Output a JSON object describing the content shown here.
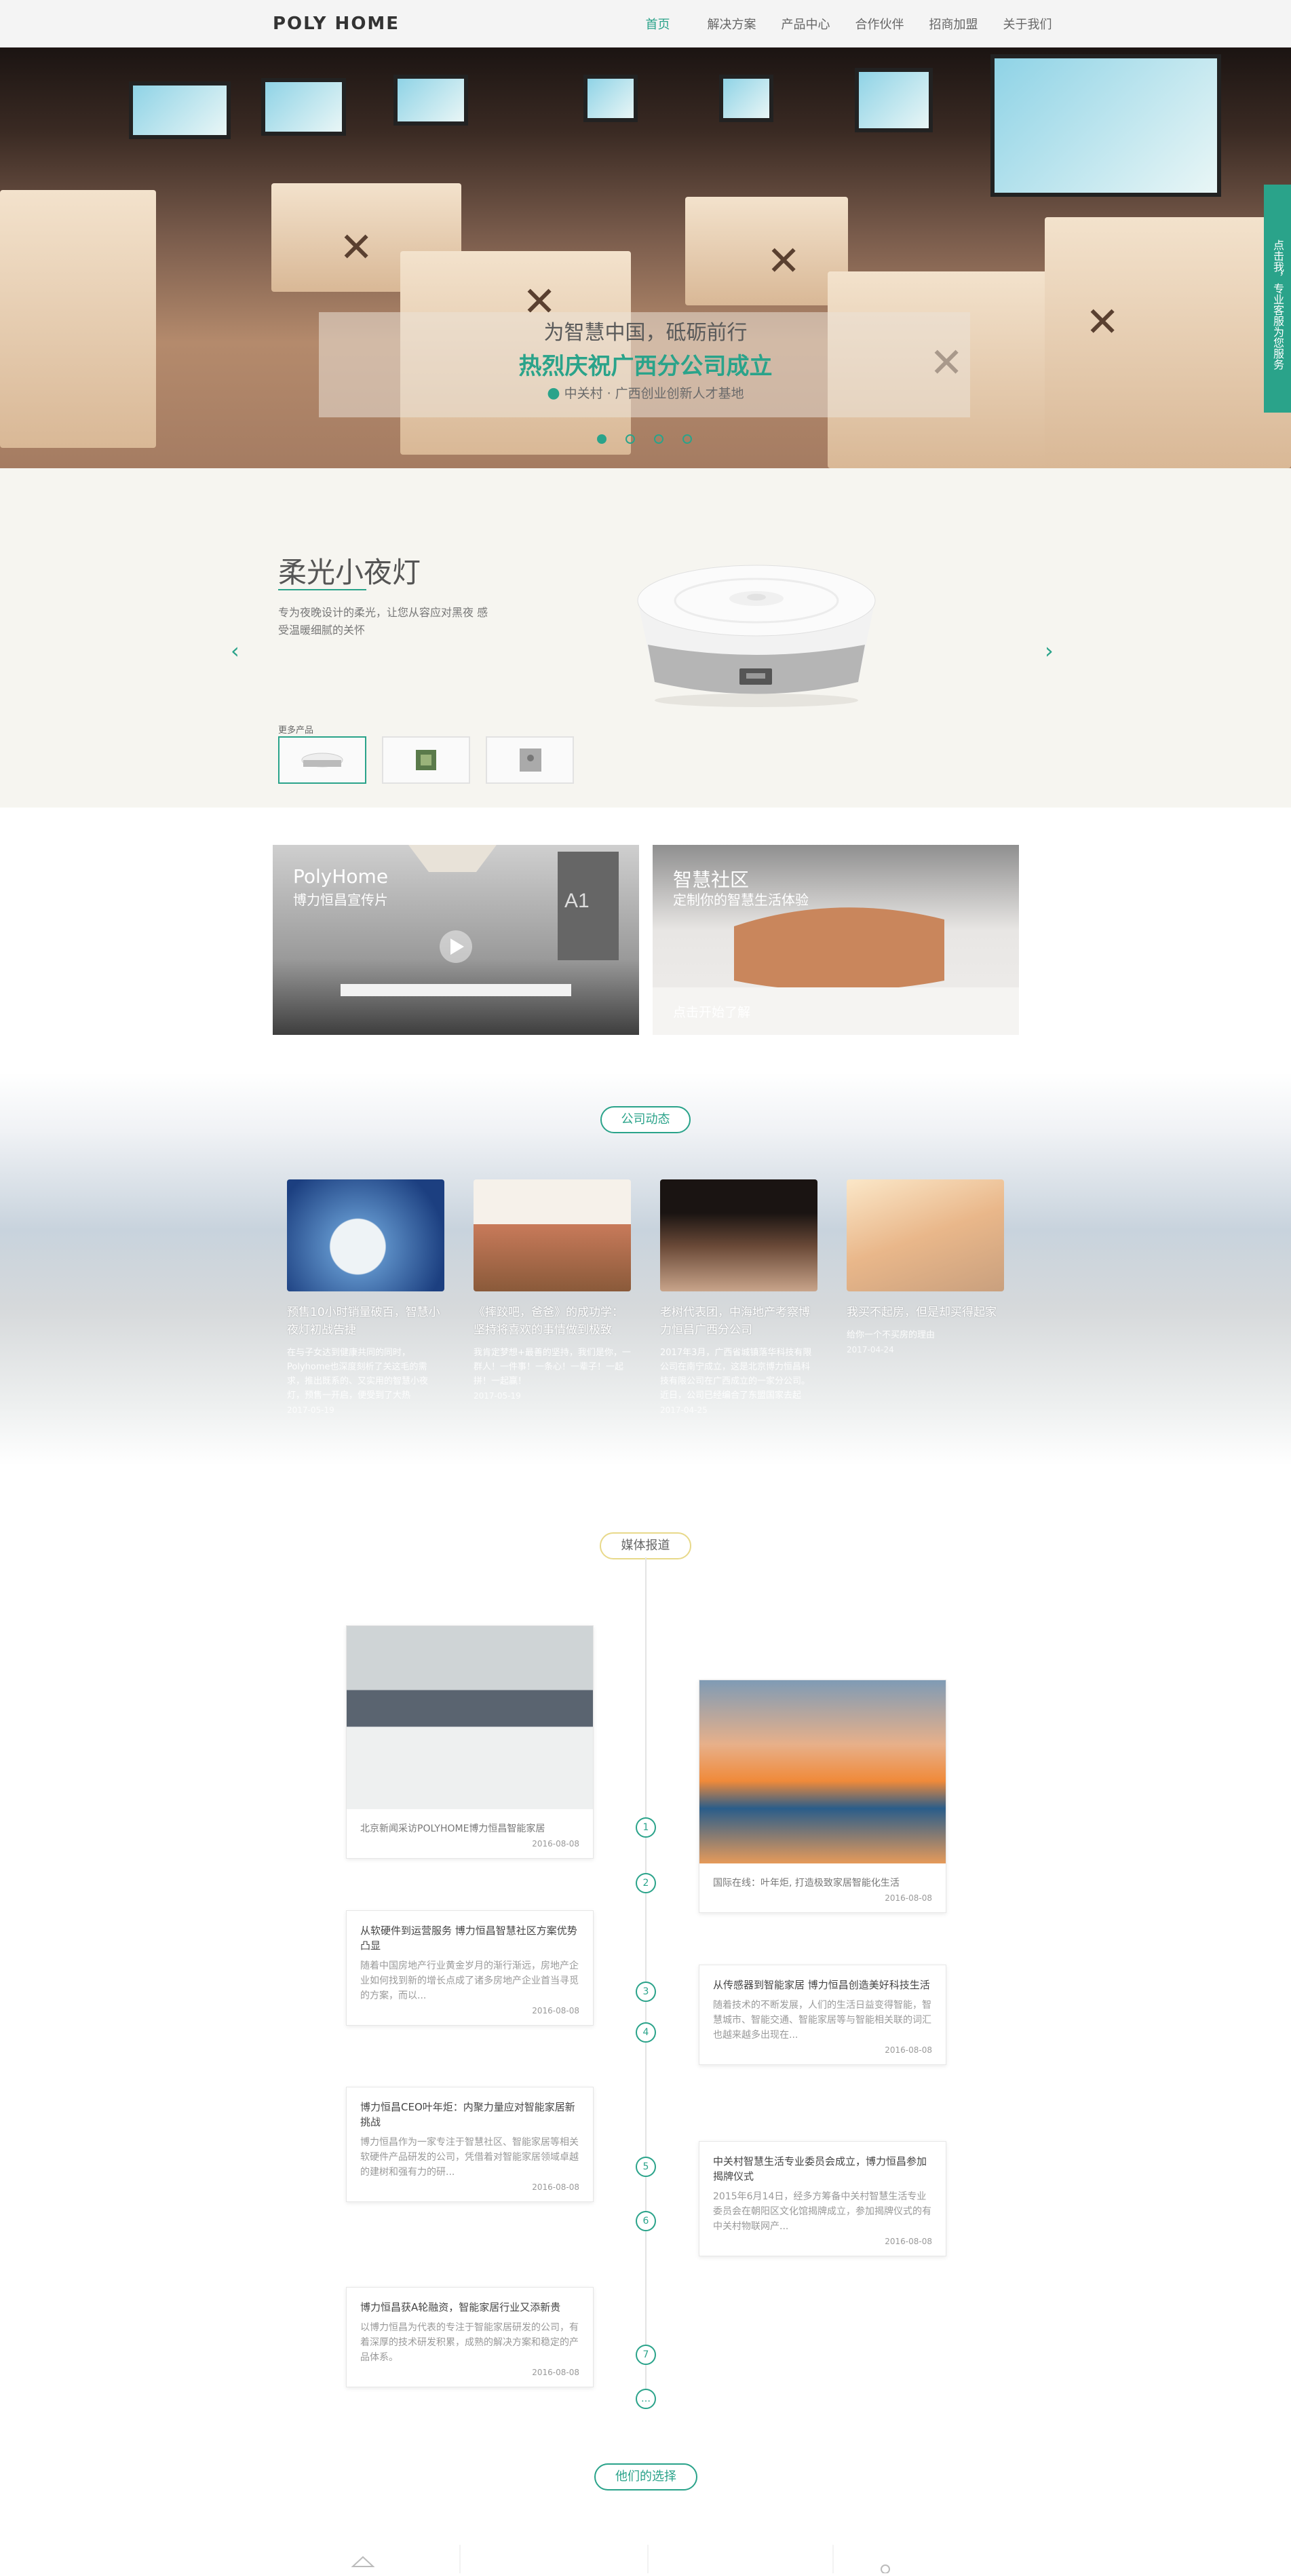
{
  "header": {
    "logo": "POLY HOME",
    "nav": [
      {
        "label": "首页",
        "active": true
      },
      {
        "label": "解决方案",
        "active": false
      },
      {
        "label": "产品中心",
        "active": false
      },
      {
        "label": "合作伙伴",
        "active": false
      },
      {
        "label": "招商加盟",
        "active": false
      },
      {
        "label": "关于我们",
        "active": false
      }
    ]
  },
  "hero": {
    "line1": "为智慧中国，砥砺前行",
    "line2": "热烈庆祝广西分公司成立",
    "location": "中关村 · 广西创业创新人才基地",
    "slides": 4,
    "active_slide": 1
  },
  "float_tab": {
    "label": "点击我，专业客服为您服务"
  },
  "product": {
    "title": "柔光小夜灯",
    "desc": "专为夜晚设计的柔光，让您从容应对黑夜 感受温暖细腻的关怀",
    "more_label": "更多产品",
    "arrow_left": "‹",
    "arrow_right": "›"
  },
  "video_cards": [
    {
      "title": "PolyHome",
      "subtitle": "博力恒昌宣传片",
      "cta": ""
    },
    {
      "title": "智慧社区",
      "subtitle": "定制你的智慧生活体验",
      "cta": "点击开始了解"
    }
  ],
  "news": {
    "label": "公司动态",
    "items": [
      {
        "title": "预售10小时销量破百，智慧小夜灯初战告捷",
        "text": "在与子女达到健康共同的同时，Polyhome也深度刻析了关这毛的需求，推出既系的、又实用的智慧小夜灯，预售一开启，便受到了大热",
        "date": "2017-05-19"
      },
      {
        "title": "《摔跤吧，爸爸》的成功学：坚持将喜欢的事情做到极致",
        "text": "我肯定梦想+最善的坚持，我们是你，一群人！一件事！一条心！一辈子！一起拼！一起赢！",
        "date": "2017-05-19"
      },
      {
        "title": "老树代表团，中海地产考察博力恒昌广西分公司",
        "text": "2017年3月，广西省城镇落华科技有限公司在南宁成立，这是北京博力恒昌科技有限公司在广西成立的一家分公司。近日，公司已经编合了东盟国家去起",
        "date": "2017-04-25"
      },
      {
        "title": "我买不起房，但是却买得起家",
        "text": "给你一个不买房的理由",
        "date": "2017-04-24"
      }
    ]
  },
  "media": {
    "label": "媒体报道",
    "items": [
      {
        "n": "1",
        "title": "北京新闻采访POLYHOME博力恒昌智能家居",
        "text": "",
        "date": "2016-08-08"
      },
      {
        "n": "2",
        "title": "国际在线：叶年炬, 打造极致家居智能化生活",
        "text": "",
        "date": "2016-08-08"
      },
      {
        "n": "3",
        "title": "从软硬件到运营服务 博力恒昌智慧社区方案优势凸显",
        "text": "随着中国房地产行业黄金岁月的渐行渐远，房地产企业如何找到新的增长点成了诸多房地产企业首当寻觅的方案，而以...",
        "date": "2016-08-08"
      },
      {
        "n": "4",
        "title": "从传感器到智能家居 博力恒昌创造美好科技生活",
        "text": "随着技术的不断发展，人们的生活日益变得智能，智慧城市、智能交通、智能家居等与智能相关联的词汇也越来越多出现在...",
        "date": "2016-08-08"
      },
      {
        "n": "5",
        "title": "博力恒昌CEO叶年炬：内聚力量应对智能家居新挑战",
        "text": "博力恒昌作为一家专注于智慧社区、智能家居等相关软硬件产品研发的公司，凭借着对智能家居领域卓越的建树和强有力的研...",
        "date": "2016-08-08"
      },
      {
        "n": "6",
        "title": "中关村智慧生活专业委员会成立，博力恒昌参加揭牌仪式",
        "text": "2015年6月14日，经多方筹备中关村智慧生活专业委员会在朝阳区文化馆揭牌成立，参加揭牌仪式的有中关村物联网产...",
        "date": "2016-08-08"
      },
      {
        "n": "7",
        "title": "博力恒昌获A轮融资，智能家居行业又添新贵",
        "text": "以博力恒昌为代表的专注于智能家居研发的公司，有着深厚的技术研发积累，成熟的解决方案和稳定的产品体系。",
        "date": "2016-08-08"
      },
      {
        "n": "…",
        "title": "",
        "text": "",
        "date": ""
      }
    ]
  },
  "choice": {
    "label": "他们的选择"
  },
  "colors": {
    "accent": "#2aa38a",
    "header_bg": "#f4f4f4",
    "product_bg": "#f6f5f0"
  },
  "icons": [
    "location-pin-icon",
    "play-icon",
    "chevron-left-icon",
    "chevron-right-icon"
  ]
}
